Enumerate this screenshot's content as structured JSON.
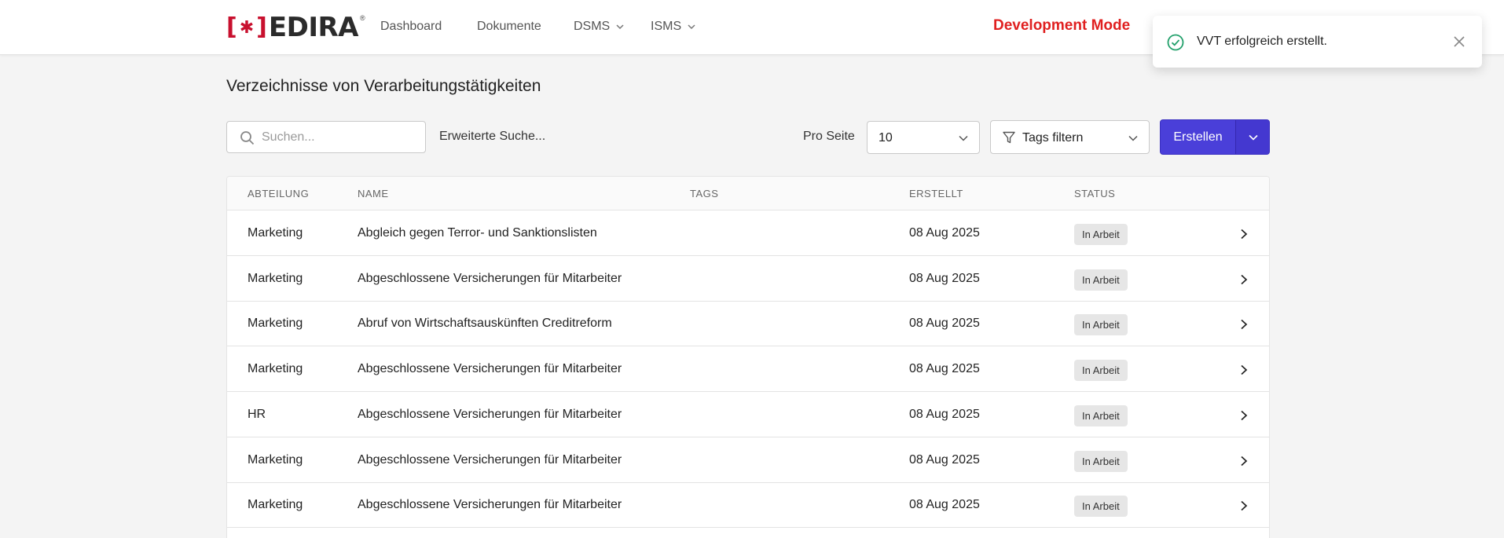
{
  "brand": {
    "logo_text": "EDIRA"
  },
  "nav": {
    "items": [
      {
        "label": "Dashboard",
        "has_dropdown": false
      },
      {
        "label": "Dokumente",
        "has_dropdown": false
      },
      {
        "label": "DSMS",
        "has_dropdown": true
      },
      {
        "label": "ISMS",
        "has_dropdown": true
      }
    ],
    "dev_mode_label": "Development Mode"
  },
  "toast": {
    "message": "VVT erfolgreich erstellt.",
    "icon": "check-circle-icon",
    "color": "#22a06b"
  },
  "page": {
    "title": "Verzeichnisse von Verarbeitungstätigkeiten"
  },
  "toolbar": {
    "search_placeholder": "Suchen...",
    "advanced_search_label": "Erweiterte Suche...",
    "per_page_label": "Pro Seite",
    "per_page_value": "10",
    "tags_filter_label": "Tags filtern",
    "create_label": "Erstellen",
    "accent": "#4a3fd9"
  },
  "table": {
    "columns": [
      "ABTEILUNG",
      "NAME",
      "TAGS",
      "ERSTELLT",
      "STATUS"
    ],
    "rows": [
      {
        "department": "Marketing",
        "name": "Abgleich gegen Terror- und Sanktionslisten",
        "tags": "",
        "created": "08 Aug 2025",
        "status": "In Arbeit"
      },
      {
        "department": "Marketing",
        "name": "Abgeschlossene Versicherungen für Mitarbeiter",
        "tags": "",
        "created": "08 Aug 2025",
        "status": "In Arbeit"
      },
      {
        "department": "Marketing",
        "name": "Abruf von Wirtschaftsauskünften Creditreform",
        "tags": "",
        "created": "08 Aug 2025",
        "status": "In Arbeit"
      },
      {
        "department": "Marketing",
        "name": "Abgeschlossene Versicherungen für Mitarbeiter",
        "tags": "",
        "created": "08 Aug 2025",
        "status": "In Arbeit"
      },
      {
        "department": "HR",
        "name": "Abgeschlossene Versicherungen für Mitarbeiter",
        "tags": "",
        "created": "08 Aug 2025",
        "status": "In Arbeit"
      },
      {
        "department": "Marketing",
        "name": "Abgeschlossene Versicherungen für Mitarbeiter",
        "tags": "",
        "created": "08 Aug 2025",
        "status": "In Arbeit"
      },
      {
        "department": "Marketing",
        "name": "Abgeschlossene Versicherungen für Mitarbeiter",
        "tags": "",
        "created": "08 Aug 2025",
        "status": "In Arbeit"
      }
    ]
  }
}
